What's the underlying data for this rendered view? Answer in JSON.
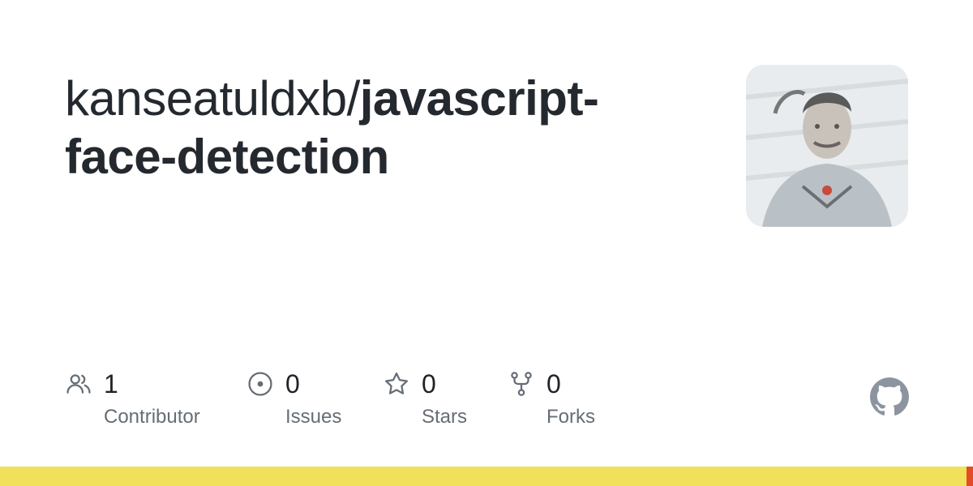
{
  "repo": {
    "owner": "kanseatuldxb/",
    "name": "javascript-face-detection"
  },
  "stats": [
    {
      "icon": "people-icon",
      "value": "1",
      "label": "Contributor"
    },
    {
      "icon": "issue-opened-icon",
      "value": "0",
      "label": "Issues"
    },
    {
      "icon": "star-icon",
      "value": "0",
      "label": "Stars"
    },
    {
      "icon": "repo-forked-icon",
      "value": "0",
      "label": "Forks"
    }
  ],
  "languages": [
    {
      "color": "#f1e05a",
      "share": 0.993
    },
    {
      "color": "#e34c26",
      "share": 0.007
    }
  ],
  "colors": {
    "icon": "#656d76",
    "github_logo": "#8c959f"
  }
}
